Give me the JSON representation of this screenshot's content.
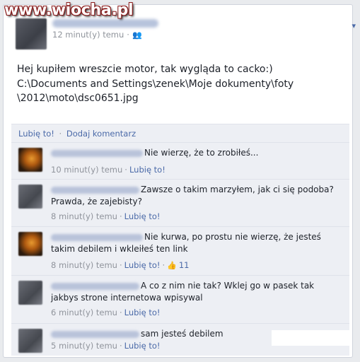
{
  "watermark": "www.wiocha.pl",
  "post": {
    "meta_time": "12 minut(y) temu",
    "meta_sep": "·",
    "text": "Hej kupiłem wreszcie motor, tak wygląda to cacko:)\nC:\\Documents and Settings\\zenek\\Moje dokumenty\\foty\n\\2012\\moto\\dsc0651.jpg"
  },
  "actions": {
    "like": "Lubię to!",
    "sep": "·",
    "comment": "Dodaj komentarz"
  },
  "comments": [
    {
      "text": "Nie wierzę, że to zrobiłeś...",
      "time": "10 minut(y) temu",
      "like": "Lubię to!",
      "avatar": "orange"
    },
    {
      "text": "Zawsze o takim marzyłem, jak ci się podoba? Prawda, że zajebisty?",
      "time": "8 minut(y) temu",
      "like": "Lubię to!",
      "avatar": "gray"
    },
    {
      "text": "Nie kurwa, po prostu nie wierzę, że jesteś takim debilem i wkleiłeś ten link",
      "time": "8 minut(y) temu",
      "like": "Lubię to!",
      "likes_count": "11",
      "avatar": "orange"
    },
    {
      "text": "A co z nim nie tak? Wklej go w pasek tak jakbys strone internetowa wpisywal",
      "time": "6 minut(y) temu",
      "like": "Lubię to!",
      "avatar": "gray"
    },
    {
      "text": "sam jesteś debilem",
      "time": "5 minut(y) temu",
      "like": "Lubię to!",
      "avatar": "gray"
    }
  ]
}
